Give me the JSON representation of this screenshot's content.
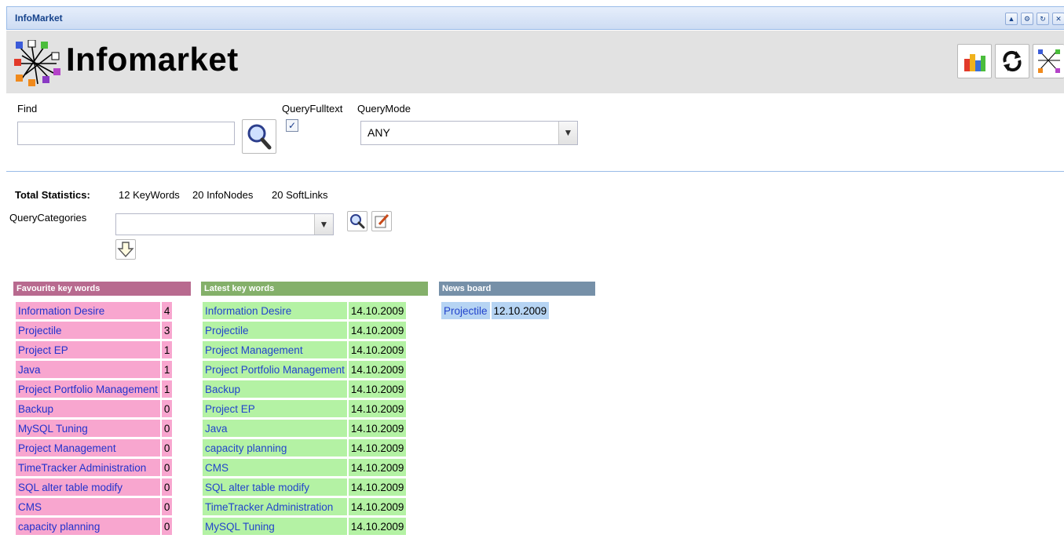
{
  "window": {
    "title": "InfoMarket"
  },
  "header": {
    "app_title": "Infomarket"
  },
  "search": {
    "find_label": "Find",
    "find_value": "",
    "fulltext_label": "QueryFulltext",
    "fulltext_checked": true,
    "mode_label": "QueryMode",
    "mode_value": "ANY"
  },
  "stats": {
    "label": "Total Statistics:",
    "keywords": "12 KeyWords",
    "infonodes": "20 InfoNodes",
    "softlinks": "20 SoftLinks"
  },
  "categories": {
    "label": "QueryCategories",
    "value": ""
  },
  "favourite": {
    "title": "Favourite key words",
    "color": "#b86a8f",
    "rows": [
      {
        "keyword": "Information Desire",
        "count": "4"
      },
      {
        "keyword": "Projectile",
        "count": "3"
      },
      {
        "keyword": "Project EP",
        "count": "1"
      },
      {
        "keyword": "Java",
        "count": "1"
      },
      {
        "keyword": "Project Portfolio Management",
        "count": "1"
      },
      {
        "keyword": "Backup",
        "count": "0"
      },
      {
        "keyword": "MySQL Tuning",
        "count": "0"
      },
      {
        "keyword": "Project Management",
        "count": "0"
      },
      {
        "keyword": "TimeTracker Administration",
        "count": "0"
      },
      {
        "keyword": "SQL alter table modify",
        "count": "0"
      },
      {
        "keyword": "CMS",
        "count": "0"
      },
      {
        "keyword": "capacity planning",
        "count": "0"
      }
    ]
  },
  "latest": {
    "title": "Latest key words",
    "color": "#84b06a",
    "rows": [
      {
        "keyword": "Information Desire",
        "date": "14.10.2009"
      },
      {
        "keyword": "Projectile",
        "date": "14.10.2009"
      },
      {
        "keyword": "Project Management",
        "date": "14.10.2009"
      },
      {
        "keyword": "Project Portfolio Management",
        "date": "14.10.2009"
      },
      {
        "keyword": "Backup",
        "date": "14.10.2009"
      },
      {
        "keyword": "Project EP",
        "date": "14.10.2009"
      },
      {
        "keyword": "Java",
        "date": "14.10.2009"
      },
      {
        "keyword": "capacity planning",
        "date": "14.10.2009"
      },
      {
        "keyword": "CMS",
        "date": "14.10.2009"
      },
      {
        "keyword": "SQL alter table modify",
        "date": "14.10.2009"
      },
      {
        "keyword": "TimeTracker Administration",
        "date": "14.10.2009"
      },
      {
        "keyword": "MySQL Tuning",
        "date": "14.10.2009"
      }
    ]
  },
  "news": {
    "title": "News board",
    "color": "#7690a8",
    "rows": [
      {
        "keyword": "Projectile",
        "date": "12.10.2009"
      }
    ]
  },
  "icons": {
    "title_tools": [
      "collapse-icon",
      "gear-icon",
      "refresh-icon",
      "close-icon"
    ],
    "header_buttons": [
      "chart-icon",
      "refresh-icon",
      "network-icon"
    ]
  }
}
